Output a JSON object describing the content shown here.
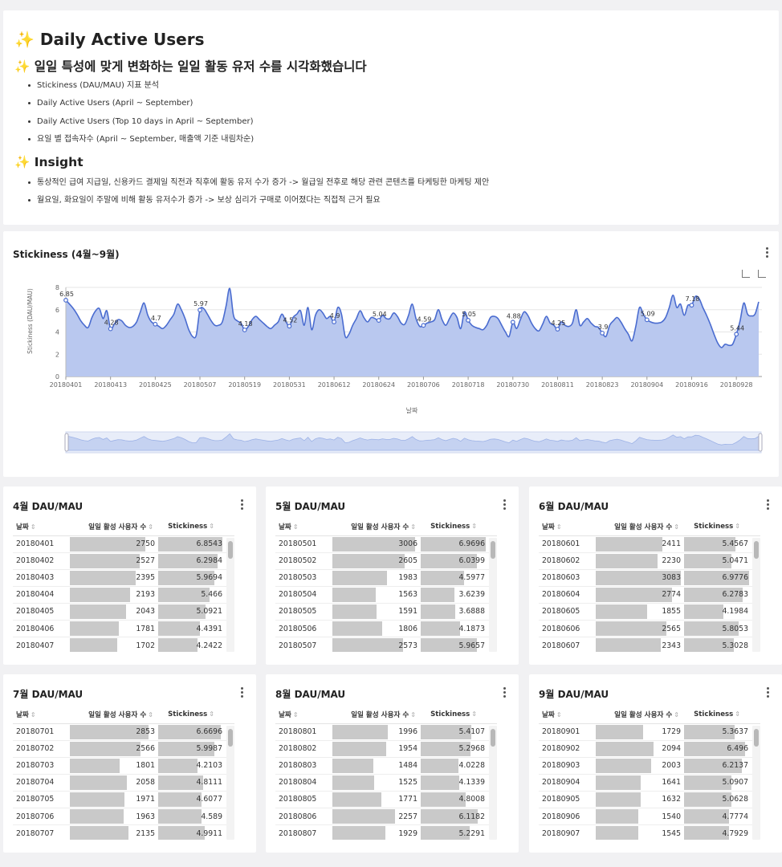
{
  "header": {
    "title": "Daily Active Users",
    "subtitle": "일일 특성에 맞게 변화하는 일일 활동 유저 수를 시각화했습니다",
    "sparkle": "✨",
    "items": [
      "Stickiness (DAU/MAU) 지표 분석",
      "Daily Active Users (April ~ September)",
      "Daily Active Users (Top 10 days in April ~ September)",
      "요일 별 접속자수 (April ~ September, 매출액 기준 내림차순)"
    ],
    "insight_title": "Insight",
    "insights": [
      "통상적인 급여 지급일, 신용카드 결제일 직전과 직후에 활동 유저 수가 증가 -> 월급일 전후로 해당 관련 콘텐츠를 타케팅한 마케팅 제안",
      "월요일, 화요일이 주말에 비해 활동 유저수가 증가 -> 보상 심리가 구매로 이어졌다는 직접적 근거 필요"
    ]
  },
  "chart_data": {
    "type": "area",
    "title": "Stickiness (4월~9월)",
    "xlabel": "날짜",
    "ylabel": "Stickiness (DAU/MAU)",
    "ylim": [
      0,
      8
    ],
    "yticks": [
      "0",
      "2",
      "4",
      "6",
      "8"
    ],
    "xticks": [
      "20180401",
      "20180413",
      "20180425",
      "20180507",
      "20180519",
      "20180531",
      "20180612",
      "20180624",
      "20180706",
      "20180718",
      "20180730",
      "20180811",
      "20180823",
      "20180904",
      "20180916",
      "20180928"
    ],
    "grid": true,
    "color": "#4a6cd0",
    "fill": "#b9c8ef",
    "annotations": [
      {
        "day": 0,
        "label": "6.85"
      },
      {
        "day": 12,
        "label": "4.28"
      },
      {
        "day": 24,
        "label": "4.7"
      },
      {
        "day": 36,
        "label": "5.97"
      },
      {
        "day": 48,
        "label": "4.18"
      },
      {
        "day": 60,
        "label": "4.52"
      },
      {
        "day": 72,
        "label": "4.9"
      },
      {
        "day": 84,
        "label": "5.04"
      },
      {
        "day": 96,
        "label": "4.59"
      },
      {
        "day": 108,
        "label": "5.05"
      },
      {
        "day": 120,
        "label": "4.88"
      },
      {
        "day": 132,
        "label": "4.25"
      },
      {
        "day": 144,
        "label": "3.9"
      },
      {
        "day": 156,
        "label": "5.09"
      },
      {
        "day": 168,
        "label": "7.18"
      },
      {
        "day": 180,
        "label": "5.44"
      }
    ],
    "values": [
      6.85,
      6.5,
      6.1,
      5.6,
      5.0,
      4.6,
      4.4,
      5.3,
      5.9,
      6.1,
      5.2,
      5.9,
      4.28,
      4.7,
      5.1,
      5.0,
      4.6,
      4.4,
      4.5,
      4.9,
      5.8,
      6.6,
      5.5,
      4.9,
      4.7,
      4.5,
      4.3,
      4.6,
      5.1,
      5.6,
      6.5,
      6.0,
      5.2,
      4.2,
      3.6,
      3.7,
      5.97,
      6.1,
      5.6,
      5.0,
      4.6,
      4.6,
      4.9,
      6.3,
      7.9,
      5.5,
      5.0,
      4.8,
      4.18,
      4.5,
      5.1,
      5.4,
      5.1,
      4.8,
      4.5,
      4.3,
      4.6,
      4.9,
      5.6,
      5.0,
      4.52,
      5.3,
      5.6,
      5.9,
      4.6,
      6.2,
      4.2,
      5.5,
      6.0,
      5.7,
      5.2,
      5.4,
      4.9,
      6.2,
      5.6,
      3.6,
      3.8,
      4.6,
      5.2,
      5.9,
      5.3,
      4.9,
      5.3,
      5.2,
      5.04,
      5.5,
      5.2,
      5.2,
      5.7,
      5.4,
      4.8,
      4.7,
      5.5,
      6.5,
      5.2,
      4.5,
      4.59,
      4.8,
      4.9,
      5.1,
      6.0,
      5.1,
      4.6,
      5.2,
      5.7,
      5.3,
      4.3,
      5.8,
      5.05,
      4.6,
      4.4,
      4.3,
      4.2,
      4.6,
      5.3,
      5.4,
      5.2,
      4.6,
      4.0,
      3.6,
      4.88,
      4.3,
      5.1,
      5.8,
      5.5,
      4.8,
      4.3,
      4.1,
      4.7,
      5.4,
      4.8,
      4.6,
      4.25,
      4.9,
      4.6,
      4.5,
      4.8,
      6.0,
      4.6,
      4.9,
      5.2,
      4.8,
      4.5,
      4.4,
      3.9,
      3.6,
      4.6,
      5.0,
      5.3,
      4.9,
      4.3,
      3.8,
      3.2,
      4.5,
      6.2,
      5.6,
      5.09,
      4.9,
      4.8,
      4.8,
      4.9,
      5.3,
      6.2,
      7.3,
      6.2,
      6.5,
      5.5,
      6.4,
      6.4,
      7.18,
      7.0,
      6.2,
      5.5,
      4.7,
      3.8,
      3.0,
      2.6,
      2.9,
      2.8,
      2.9,
      3.8,
      5.0,
      6.6,
      5.6,
      5.44,
      5.6,
      6.7
    ]
  },
  "tables": [
    {
      "title": "4월 DAU/MAU",
      "rows": [
        [
          "20180401",
          "2750",
          "6.8543"
        ],
        [
          "20180402",
          "2527",
          "6.2984"
        ],
        [
          "20180403",
          "2395",
          "5.9694"
        ],
        [
          "20180404",
          "2193",
          "5.466"
        ],
        [
          "20180405",
          "2043",
          "5.0921"
        ],
        [
          "20180406",
          "1781",
          "4.4391"
        ],
        [
          "20180407",
          "1702",
          "4.2422"
        ]
      ]
    },
    {
      "title": "5월 DAU/MAU",
      "rows": [
        [
          "20180501",
          "3006",
          "6.9696"
        ],
        [
          "20180502",
          "2605",
          "6.0399"
        ],
        [
          "20180503",
          "1983",
          "4.5977"
        ],
        [
          "20180504",
          "1563",
          "3.6239"
        ],
        [
          "20180505",
          "1591",
          "3.6888"
        ],
        [
          "20180506",
          "1806",
          "4.1873"
        ],
        [
          "20180507",
          "2573",
          "5.9657"
        ]
      ]
    },
    {
      "title": "6월 DAU/MAU",
      "rows": [
        [
          "20180601",
          "2411",
          "5.4567"
        ],
        [
          "20180602",
          "2230",
          "5.0471"
        ],
        [
          "20180603",
          "3083",
          "6.9776"
        ],
        [
          "20180604",
          "2774",
          "6.2783"
        ],
        [
          "20180605",
          "1855",
          "4.1984"
        ],
        [
          "20180606",
          "2565",
          "5.8053"
        ],
        [
          "20180607",
          "2343",
          "5.3028"
        ]
      ]
    },
    {
      "title": "7월 DAU/MAU",
      "rows": [
        [
          "20180701",
          "2853",
          "6.6696"
        ],
        [
          "20180702",
          "2566",
          "5.9987"
        ],
        [
          "20180703",
          "1801",
          "4.2103"
        ],
        [
          "20180704",
          "2058",
          "4.8111"
        ],
        [
          "20180705",
          "1971",
          "4.6077"
        ],
        [
          "20180706",
          "1963",
          "4.589"
        ],
        [
          "20180707",
          "2135",
          "4.9911"
        ]
      ]
    },
    {
      "title": "8월 DAU/MAU",
      "rows": [
        [
          "20180801",
          "1996",
          "5.4107"
        ],
        [
          "20180802",
          "1954",
          "5.2968"
        ],
        [
          "20180803",
          "1484",
          "4.0228"
        ],
        [
          "20180804",
          "1525",
          "4.1339"
        ],
        [
          "20180805",
          "1771",
          "4.8008"
        ],
        [
          "20180806",
          "2257",
          "6.1182"
        ],
        [
          "20180807",
          "1929",
          "5.2291"
        ]
      ]
    },
    {
      "title": "9월 DAU/MAU",
      "rows": [
        [
          "20180901",
          "1729",
          "5.3637"
        ],
        [
          "20180902",
          "2094",
          "6.496"
        ],
        [
          "20180903",
          "2003",
          "6.2137"
        ],
        [
          "20180904",
          "1641",
          "5.0907"
        ],
        [
          "20180905",
          "1632",
          "5.0628"
        ],
        [
          "20180906",
          "1540",
          "4.7774"
        ],
        [
          "20180907",
          "1545",
          "4.7929"
        ]
      ]
    }
  ],
  "table_columns": [
    "날짜",
    "일일 활성 사용자 수",
    "Stickiness"
  ],
  "sort_glyph": "⇕",
  "bar_scale": {
    "dau_max": 3200,
    "stick_max": 7.2
  }
}
